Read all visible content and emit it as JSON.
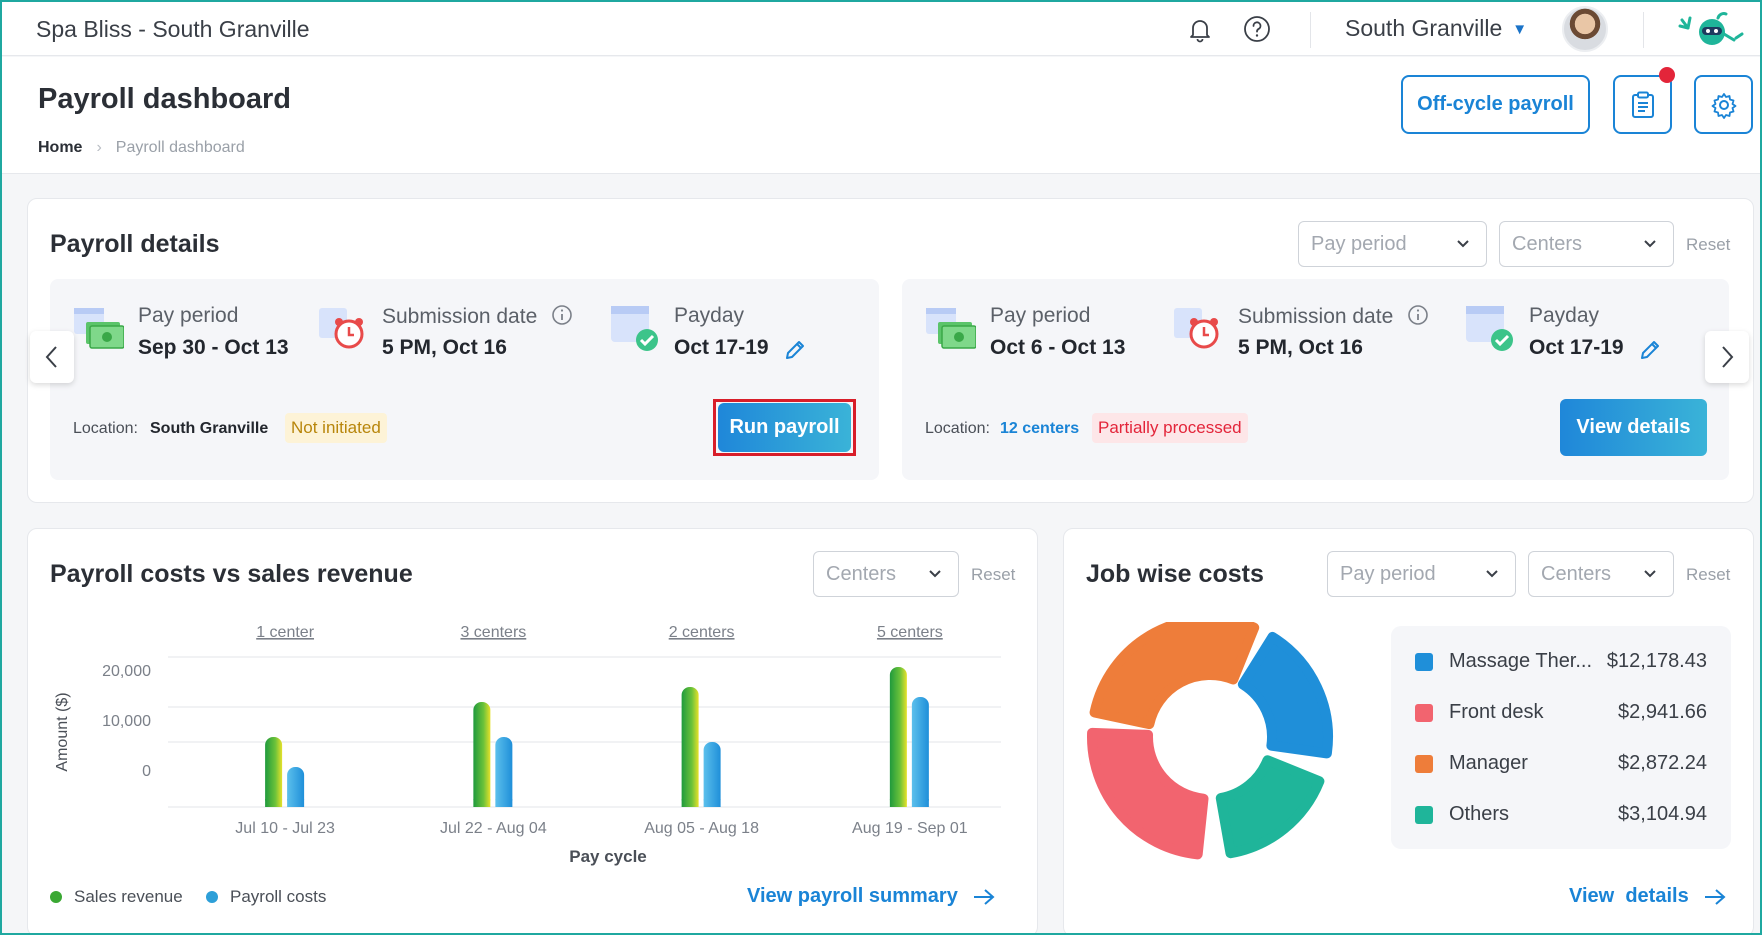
{
  "app": {
    "brand": "Spa Bliss - South Granville",
    "location_switcher": "South Granville"
  },
  "header": {
    "title": "Payroll dashboard",
    "breadcrumb": [
      "Home",
      "Payroll dashboard"
    ],
    "off_cycle_button": "Off-cycle payroll"
  },
  "payroll_details": {
    "title": "Payroll details",
    "filters": {
      "pay_period_placeholder": "Pay period",
      "centers_placeholder": "Centers",
      "reset": "Reset"
    },
    "cards": [
      {
        "pay_period_label": "Pay period",
        "pay_period_value": "Sep 30 - Oct 13",
        "submission_label": "Submission date",
        "submission_value": "5 PM, Oct 16",
        "payday_label": "Payday",
        "payday_value": "Oct 17-19",
        "location_label": "Location:",
        "location_value": "South Granville",
        "status": "Not initiated",
        "action": "Run payroll"
      },
      {
        "pay_period_label": "Pay period",
        "pay_period_value": "Oct 6 - Oct 13",
        "submission_label": "Submission date",
        "submission_value": "5 PM, Oct 16",
        "payday_label": "Payday",
        "payday_value": "Oct 17-19",
        "location_label": "Location:",
        "location_value": "12 centers",
        "status": "Partially processed",
        "action": "View details"
      }
    ]
  },
  "costs_vs_revenue": {
    "title": "Payroll costs vs sales revenue",
    "filters": {
      "centers_placeholder": "Centers",
      "reset": "Reset"
    },
    "view_link": "View payroll summary",
    "chart_data": {
      "type": "bar",
      "categories": [
        "Jul 10 - Jul 23",
        "Jul 22 - Aug 04",
        "Aug 05 - Aug 18",
        "Aug 19 - Sep 01"
      ],
      "category_annotations": [
        "1 center",
        "3 centers",
        "2 centers",
        "5 centers"
      ],
      "series": [
        {
          "name": "Sales revenue",
          "values": [
            14000,
            21000,
            24000,
            28000
          ],
          "color": "#3aa833"
        },
        {
          "name": "Payroll costs",
          "values": [
            8000,
            14000,
            13000,
            22000
          ],
          "color": "#2d9fd8"
        }
      ],
      "xlabel": "Pay cycle",
      "ylabel": "Amount ($)",
      "yticks": [
        "20,000",
        "10,000",
        "0"
      ],
      "legend_position": "bottom-left"
    }
  },
  "job_costs": {
    "title": "Job wise costs",
    "filters": {
      "pay_period_placeholder": "Pay period",
      "centers_placeholder": "Centers",
      "reset": "Reset"
    },
    "view_link": "View  details",
    "chart_data": {
      "type": "pie",
      "labels": [
        "Massage Ther...",
        "Front desk",
        "Manager",
        "Others"
      ],
      "amounts": [
        "$12,178.43",
        "$2,941.66",
        "$2,872.24",
        "$3,104.94"
      ],
      "values": [
        12178.43,
        2941.66,
        2872.24,
        3104.94
      ],
      "colors": [
        "#1f8fd9",
        "#f2646f",
        "#ee7d3a",
        "#1fb59a"
      ]
    }
  }
}
